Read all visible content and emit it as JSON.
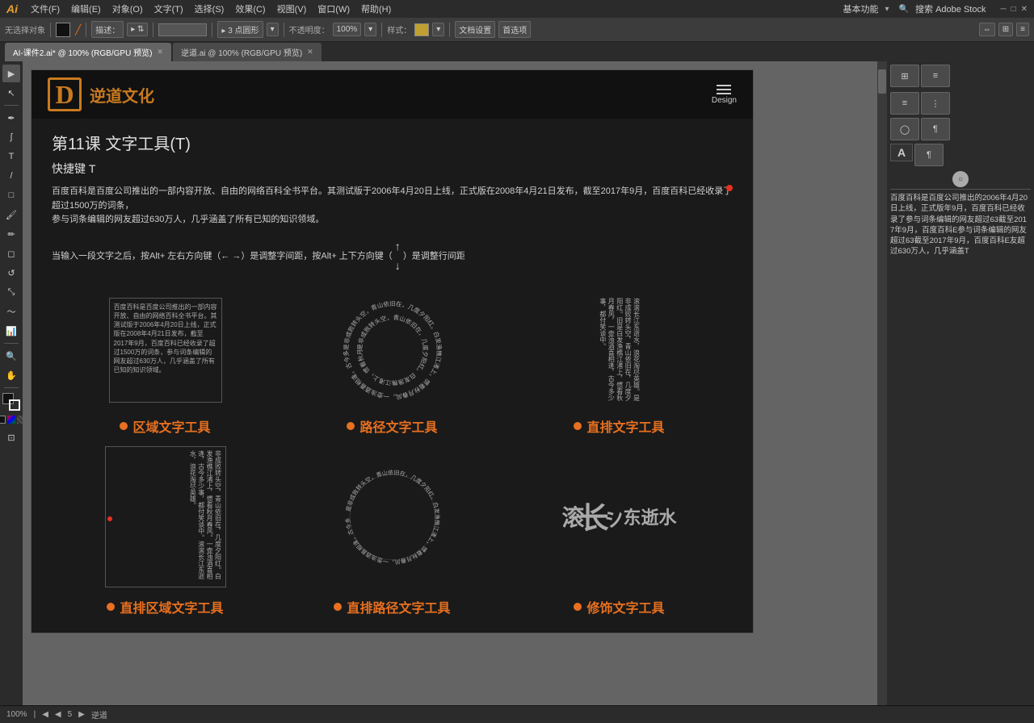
{
  "app": {
    "logo": "Ai",
    "logo_color": "#e8a030"
  },
  "menu": {
    "items": [
      "文件(F)",
      "编辑(E)",
      "对象(O)",
      "文字(T)",
      "选择(S)",
      "效果(C)",
      "视图(V)",
      "窗口(W)",
      "帮助(H)"
    ]
  },
  "toolbar": {
    "selection_label": "无选择对象",
    "blend_label": "描述：",
    "points": "▸ 3 点圆形",
    "opacity_label": "不透明度：",
    "opacity_value": "100%",
    "style_label": "样式：",
    "doc_settings": "文档设置",
    "preferences": "首选项"
  },
  "tabs": [
    {
      "label": "AI-课件2.ai* @ 100% (RGB/GPU 预览)",
      "active": true
    },
    {
      "label": "逆道.ai @ 100% (RGB/GPU 预览)",
      "active": false
    }
  ],
  "document": {
    "logo_symbol": "D",
    "logo_text": "逆道文化",
    "menu_icon_label": "Design",
    "title": "第11课   文字工具(T)",
    "shortcut": "快捷键 T",
    "body_text": "百度百科是百度公司推出的一部内容开放、自由的网络百科全书平台。其测试版于2006年4月20日上线，正式版在2008年4月21日发布，截至2017年9月，百度百科已经收录了超过1500万的词条，\n参与词条编辑的网友超过630万人，几乎涵盖了所有已知的知识领域。",
    "desc_text": "当输入一段文字之后，按Alt+ 左右方向键（← →）是调整字间距，按Alt+ 上下方向键（↑↓）是调整行间距",
    "examples": [
      {
        "type": "area",
        "label": "区域文字工具",
        "content": "百度百科是百度公司推出的一部内容开放、自由的网络百科全书平台。其测试版于2006年4月20日上线，正式版在2008年4月21日发布，截至2017年9月，百度百科已经收录了超过1500万的词条，参与词条编辑的网友超过630万人，几乎涵盖了所有已知的知识领域。"
      },
      {
        "type": "path",
        "label": "路径文字工具",
        "content": "是非成败转头空，青山依旧在，几度夕阳红。白发渔樵江渚上，惯看秋月春风。一壶浊酒喜相逢，古今多少事，都付笑谈中。"
      },
      {
        "type": "vertical",
        "label": "直排文字工具",
        "content": "滚滚长江东逝水，浪花淘尽英雄。是非成败转头空，青山依旧在，几度夕阳红。旧是白发渔樵江渚上，惯看秋月春风，一壶浊酒喜相逢，古今多少事，都付笑谈中。"
      }
    ],
    "examples2": [
      {
        "type": "v-area",
        "label": "直排区域文字工具",
        "content": "非成败转头空，青山依旧在，几度夕阳红。白发渔樵江渚上，惯看秋月春风。一壶浊酒喜相逢，古今多少事，都付笑谈中。滚滚长江东逝水，浪花淘尽英雄。"
      },
      {
        "type": "v-path",
        "label": "直排路径文字工具"
      },
      {
        "type": "deco",
        "label": "修饰文字工具",
        "content": "滚长 东逝水"
      }
    ]
  },
  "right_panel": {
    "title": "基本功能",
    "search_placeholder": "搜索 Adobe Stock",
    "text": "百度百科是百度公司推出的2006年4月20日上线，正式版年9月，百度百科已经收录了参与词条编辑的网友超过63截至2017年9月，百度百科E参与词条编辑的网友超过63截至2017年9月，百度百科E友超过630万人，几乎涵盖T"
  },
  "status_bar": {
    "zoom": "100%",
    "page": "5",
    "info": "逆道"
  }
}
